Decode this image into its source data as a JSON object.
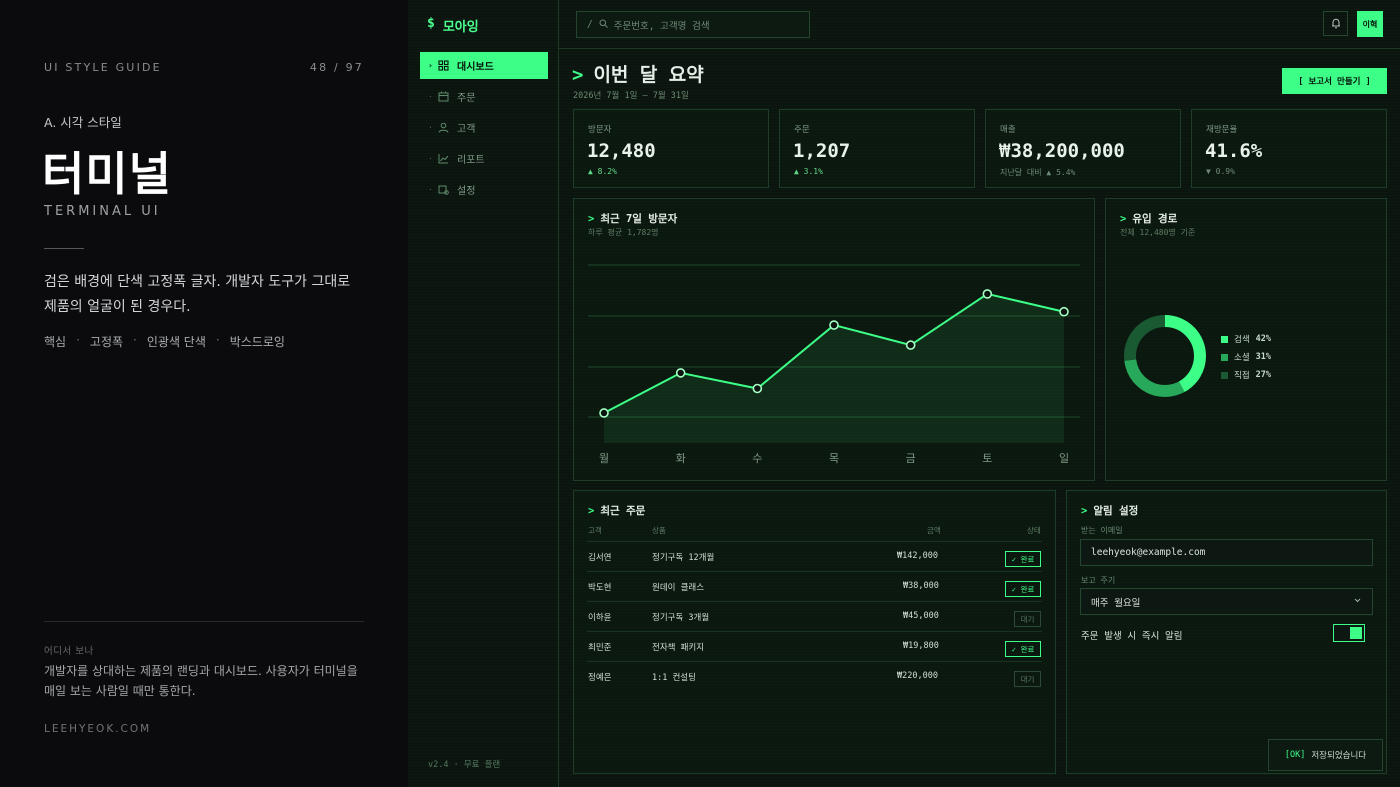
{
  "guide": {
    "label": "UI STYLE GUIDE",
    "page": "48 / 97",
    "section": "A. 시각 스타일",
    "title": "터미널",
    "subtitle": "TERMINAL UI",
    "description": "검은 배경에 단색 고정폭 글자. 개발자 도구가 그대로 제품의 얼굴이 된 경우다.",
    "tags": [
      "핵심",
      "고정폭",
      "인광색 단색",
      "박스드로잉"
    ],
    "where_label": "어디서 보나",
    "where_text": "개발자를 상대하는 제품의 랜딩과 대시보드. 사용자가 터미널을 매일 보는 사람일 때만 통한다.",
    "footer": "LEEHYEOK.COM"
  },
  "app": {
    "brand_symbol": "$",
    "brand_name": "모아잉",
    "nav": [
      {
        "label": "대시보드",
        "icon": "grid-icon",
        "active": true
      },
      {
        "label": "주문",
        "icon": "calendar-icon",
        "active": false
      },
      {
        "label": "고객",
        "icon": "user-icon",
        "active": false
      },
      {
        "label": "리포트",
        "icon": "chart-icon",
        "active": false
      },
      {
        "label": "설정",
        "icon": "settings-icon",
        "active": false
      }
    ],
    "version": "v2.4 · 무료 플랜",
    "search": {
      "prefix": "/",
      "placeholder": "주문번호, 고객명 검색"
    },
    "avatar": "이혁",
    "accent": "#3dff88"
  },
  "header": {
    "title": "이번 달 요약",
    "range": "2026년 7월 1일 — 7월 31일",
    "report_button": "[ 보고서 만들기 ]"
  },
  "kpis": [
    {
      "label": "방문자",
      "value": "12,480",
      "delta": "▲ 8.2%"
    },
    {
      "label": "주문",
      "value": "1,207",
      "delta": "▲ 3.1%"
    },
    {
      "label": "매출",
      "value": "₩38,200,000",
      "delta": "지난달 대비 ▲ 5.4%"
    },
    {
      "label": "재방문율",
      "value": "41.6%",
      "delta": "▼ 0.9%"
    }
  ],
  "visitors_panel": {
    "title": "최근 7일 방문자",
    "subtitle": "하루 평균 1,782명"
  },
  "channels_panel": {
    "title": "유입 경로",
    "subtitle": "전체 12,480명 기준"
  },
  "chart_data": [
    {
      "type": "area",
      "categories": [
        "월",
        "화",
        "수",
        "목",
        "금",
        "토",
        "일"
      ],
      "values": [
        1220,
        1580,
        1440,
        2010,
        1830,
        2290,
        2130
      ],
      "ylim": [
        950,
        2550
      ],
      "grid": true,
      "color": "#3dff88"
    },
    {
      "type": "pie",
      "donut": true,
      "labels": [
        "검색",
        "소셜",
        "직접"
      ],
      "values": [
        42,
        31,
        27
      ],
      "display": [
        "42%",
        "31%",
        "27%"
      ],
      "colors": [
        "#3dff88",
        "#27a85a",
        "#1a5a33"
      ],
      "legend": "right"
    }
  ],
  "orders": {
    "title": "최근 주문",
    "columns": [
      "고객",
      "상품",
      "금액",
      "상태"
    ],
    "rows": [
      {
        "customer": "김서연",
        "product": "정기구독 12개월",
        "amount": "₩142,000",
        "status": "✓ 완료",
        "done": true
      },
      {
        "customer": "박도현",
        "product": "원데이 클래스",
        "amount": "₩38,000",
        "status": "✓ 완료",
        "done": true
      },
      {
        "customer": "이하윤",
        "product": "정기구독 3개월",
        "amount": "₩45,000",
        "status": "대기",
        "done": false
      },
      {
        "customer": "최민준",
        "product": "전자책 패키지",
        "amount": "₩19,800",
        "status": "✓ 완료",
        "done": true
      },
      {
        "customer": "정예은",
        "product": "1:1 컨설팅",
        "amount": "₩220,000",
        "status": "대기",
        "done": false
      }
    ]
  },
  "alerts": {
    "title": "알림 설정",
    "email_label": "받는 이메일",
    "email_value": "leehyeok@example.com",
    "cycle_label": "보고 주기",
    "cycle_value": "매주 월요일",
    "toggle_label": "주문 발생 시 즉시 알림",
    "toggle_on": true
  },
  "toast": {
    "tag": "[OK]",
    "message": "저장되었습니다"
  }
}
